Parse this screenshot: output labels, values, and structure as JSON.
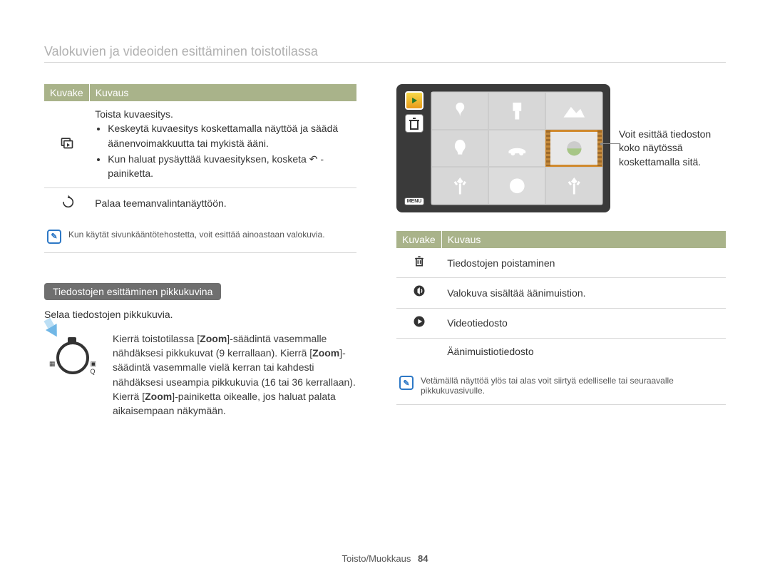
{
  "page_title": "Valokuvien ja videoiden esittäminen toistotilassa",
  "left": {
    "table_headers": [
      "Kuvake",
      "Kuvaus"
    ],
    "rows": [
      {
        "icon": "slideshow-icon",
        "title": "Toista kuvaesitys.",
        "bullets": [
          "Keskeytä kuvaesitys koskettamalla näyttöä ja säädä äänenvoimakkuutta tai mykistä ääni.",
          "Kun haluat pysäyttää kuvaesityksen, kosketa ↶ -painiketta."
        ]
      },
      {
        "icon": "back-icon",
        "desc": "Palaa teemanvalintanäyttöön."
      }
    ],
    "note": "Kun käytät sivunkääntötehostetta, voit esittää ainoastaan valokuvia.",
    "section_title": "Tiedostojen esittäminen pikkukuvina",
    "section_sub": "Selaa tiedostojen pikkukuvia.",
    "zoom_parts": [
      "Kierrä toistotilassa [",
      "Zoom",
      "]-säädintä vasemmalle nähdäksesi pikkukuvat (9 kerrallaan). Kierrä [",
      "Zoom",
      "]-säädintä vasemmalle vielä kerran tai kahdesti nähdäksesi useampia pikkukuvia (16 tai 36 kerrallaan). Kierrä [",
      "Zoom",
      "]-painiketta oikealle, jos haluat palata aikaisempaan näkymään."
    ]
  },
  "right": {
    "callout": "Voit esittää tiedoston koko näytössä koskettamalla sitä.",
    "menu_label": "MENU",
    "table_headers": [
      "Kuvake",
      "Kuvaus"
    ],
    "rows": [
      {
        "icon": "trash-icon",
        "desc": "Tiedostojen poistaminen"
      },
      {
        "icon": "sound-memo-icon",
        "desc": "Valokuva sisältää äänimuistion."
      },
      {
        "icon": "video-file-icon",
        "desc": "Videotiedosto"
      },
      {
        "icon": "audio-file-icon",
        "desc": "Äänimuistiotiedosto"
      }
    ],
    "note": "Vetämällä näyttöä ylös tai alas voit siirtyä edelliselle tai seuraavalle pikkukuvasivulle."
  },
  "footer": {
    "section": "Toisto/Muokkaus",
    "page": "84"
  }
}
